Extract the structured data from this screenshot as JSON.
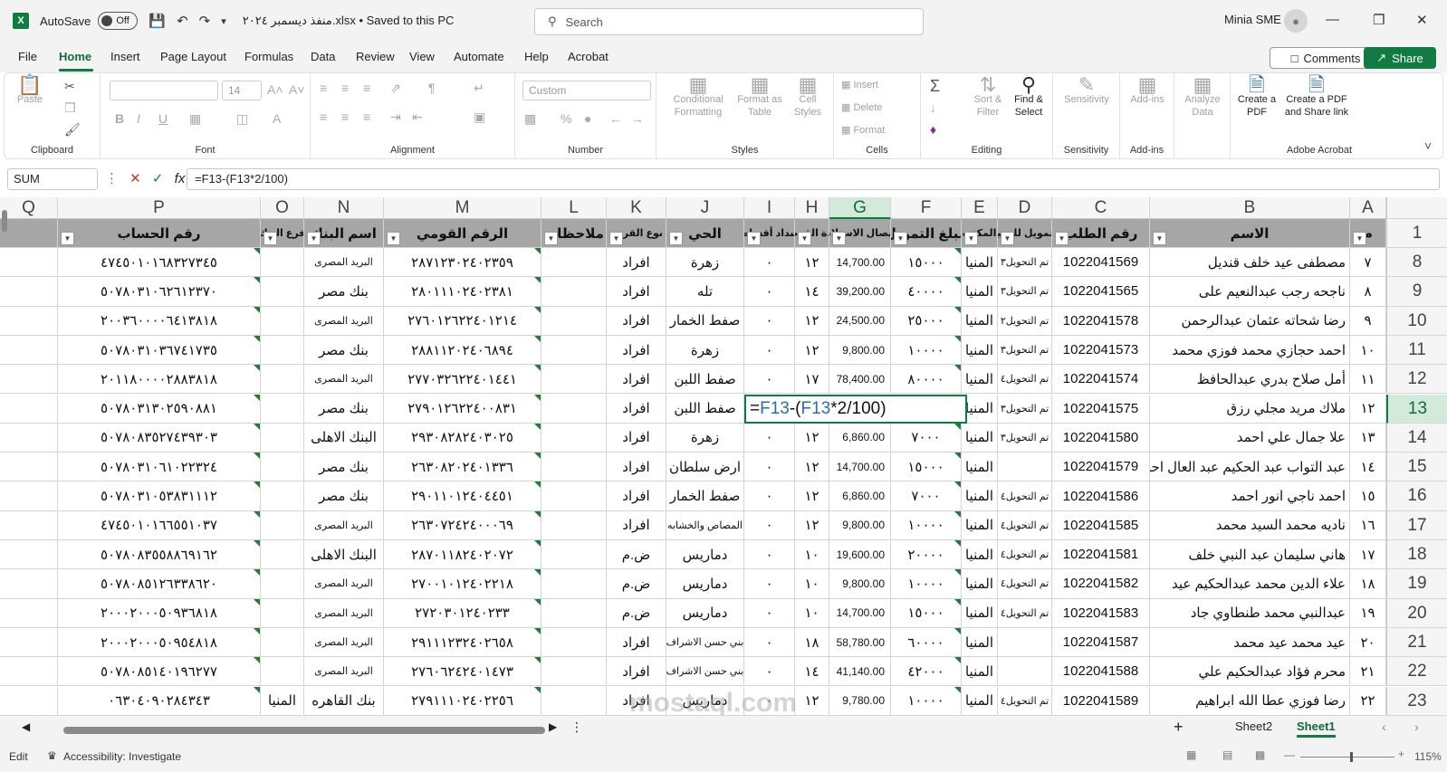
{
  "titlebar": {
    "autosave_label": "AutoSave",
    "autosave_state": "Off",
    "filename": "منفذ ديسمبر ٢٠٢٤.xlsx • Saved to this PC",
    "search_placeholder": "Search",
    "user_name": "Minia SME"
  },
  "menu": {
    "items": [
      "File",
      "Home",
      "Insert",
      "Page Layout",
      "Formulas",
      "Data",
      "Review",
      "View",
      "Automate",
      "Help",
      "Acrobat"
    ],
    "comments": "Comments",
    "share": "Share"
  },
  "ribbon": {
    "clipboard": {
      "label": "Clipboard",
      "paste": "Paste"
    },
    "font": {
      "label": "Font",
      "size": "14"
    },
    "alignment": {
      "label": "Alignment"
    },
    "number": {
      "label": "Number",
      "format": "Custom"
    },
    "styles": {
      "label": "Styles",
      "conditional": "Conditional Formatting",
      "format_table": "Format as Table",
      "cell_styles": "Cell Styles"
    },
    "cells": {
      "label": "Cells",
      "insert": "Insert",
      "delete": "Delete",
      "format": "Format"
    },
    "editing": {
      "label": "Editing",
      "sort": "Sort & Filter",
      "find": "Find & Select"
    },
    "sensitivity": {
      "label": "Sensitivity",
      "btn": "Sensitivity"
    },
    "addins": {
      "label": "Add-ins",
      "btn": "Add-ins"
    },
    "analyze": {
      "btn": "Analyze Data"
    },
    "acrobat": {
      "label": "Adobe Acrobat",
      "create_pdf": "Create a PDF",
      "create_share": "Create a PDF and Share link"
    }
  },
  "formula_bar": {
    "name_box": "SUM",
    "formula": "=F13-(F13*2/100)"
  },
  "columns": {
    "letters": [
      "A",
      "B",
      "C",
      "D",
      "E",
      "F",
      "G",
      "H",
      "I",
      "J",
      "K",
      "L",
      "M",
      "N",
      "O",
      "P",
      "Q"
    ],
    "selected": "G"
  },
  "header_row": {
    "row_number": "1",
    "A": "م",
    "B": "الاسم",
    "C": "رقم الطلب",
    "D": "التمويل للعميل",
    "E": "المكتب",
    "F": "مبلغ التمويل",
    "G": "إيصال الاستلام",
    "H": "مدة القرض",
    "I": "سداد أقساط",
    "J": "الحي",
    "K": "نوع القرض",
    "L": "ملاحظات",
    "M": "الرقم القومي",
    "N": "اسم البنك",
    "O": "فرع البنك",
    "P": "رقم الحساب"
  },
  "selected_row": "13",
  "edit_cell": {
    "prefix": "=",
    "ref1": "F13",
    "mid": "-(",
    "ref2": "F13",
    "suffix": "*2/100)"
  },
  "rows": [
    {
      "r": "8",
      "A": "٧",
      "B": "مصطفى عيد خلف قنديل",
      "C": "1022041569",
      "D": "تم التحويل٣",
      "E": "المنيا",
      "F": "١٥٠٠٠",
      "G": "14,700.00",
      "H": "١٢",
      "I": "٠",
      "J": "زهرة",
      "K": "افراد",
      "M": "٢٨٧١٢٣٠٢٤٠٢٣٥٩",
      "N": "البريد المصرى",
      "O": "",
      "P": "٤٧٤٥٠١٠١٦٨٣٢٧٣٤٥"
    },
    {
      "r": "9",
      "A": "٨",
      "B": "ناجحه رجب عبدالنعيم على",
      "C": "1022041565",
      "D": "تم التحويل٣",
      "E": "المنيا",
      "F": "٤٠٠٠٠",
      "G": "39,200.00",
      "H": "١٤",
      "I": "٠",
      "J": "تله",
      "K": "افراد",
      "M": "٢٨٠١١١٠٢٤٠٢٣٨١",
      "N": "بنك مصر",
      "O": "",
      "P": "٥٠٧٨٠٣١٠٦٢٦١٢٣٧٠"
    },
    {
      "r": "10",
      "A": "٩",
      "B": "رضا شحاته عثمان عبدالرحمن",
      "C": "1022041578",
      "D": "تم التحويل٢",
      "E": "المنيا",
      "F": "٢٥٠٠٠",
      "G": "24,500.00",
      "H": "١٢",
      "I": "٠",
      "J": "صفط الخمار",
      "K": "افراد",
      "M": "٢٧٦٠١٢٦٢٢٤٠١٢١٤",
      "N": "البريد المصرى",
      "O": "",
      "P": "٢٠٠٣٦٠٠٠٠٦٤١٣٨١٨"
    },
    {
      "r": "11",
      "A": "١٠",
      "B": "احمد حجازي محمد فوزي محمد",
      "C": "1022041573",
      "D": "تم التحويل٣",
      "E": "المنيا",
      "F": "١٠٠٠٠",
      "G": "9,800.00",
      "H": "١٢",
      "I": "٠",
      "J": "زهرة",
      "K": "افراد",
      "M": "٢٨٨١١٢٠٢٤٠٦٨٩٤",
      "N": "بنك مصر",
      "O": "",
      "P": "٥٠٧٨٠٣١٠٣٦٧٤١٧٣٥"
    },
    {
      "r": "12",
      "A": "١١",
      "B": "أمل صلاح بدري عبدالحافظ",
      "C": "1022041574",
      "D": "تم التحويل٤",
      "E": "المنيا",
      "F": "٨٠٠٠٠",
      "G": "78,400.00",
      "H": "١٧",
      "I": "٠",
      "J": "صفط اللبن",
      "K": "افراد",
      "M": "٢٧٧٠٣٢٦٢٢٤٠١٤٤١",
      "N": "البريد المصرى",
      "O": "",
      "P": "٢٠١١٨٠٠٠٠٢٨٨٣٨١٨"
    },
    {
      "r": "13",
      "A": "١٢",
      "B": "ملاك مريد مجلي رزق",
      "C": "1022041575",
      "D": "تم التحويل٣",
      "E": "المنيا",
      "F": "",
      "G": "",
      "H": "",
      "I": "",
      "J": "صفط اللبن",
      "K": "افراد",
      "M": "٢٧٩٠١٢٦٢٢٤٠٠٨٣١",
      "N": "بنك مصر",
      "O": "",
      "P": "٥٠٧٨٠٣١٣٠٢٥٩٠٨٨١"
    },
    {
      "r": "14",
      "A": "١٣",
      "B": "علا جمال علي احمد",
      "C": "1022041580",
      "D": "تم التحويل٣",
      "E": "المنيا",
      "F": "٧٠٠٠",
      "G": "6,860.00",
      "H": "١٢",
      "I": "٠",
      "J": "زهرة",
      "K": "افراد",
      "M": "٢٩٣٠٨٢٨٢٤٠٣٠٢٥",
      "N": "البنك الاهلى",
      "O": "",
      "P": "٥٠٧٨٠٨٣٥٢٧٤٣٩٣٠٣"
    },
    {
      "r": "15",
      "A": "١٤",
      "B": "عبد التواب عبد الحكيم عبد العال احمد",
      "C": "1022041579",
      "D": "",
      "E": "المنيا",
      "F": "١٥٠٠٠",
      "G": "14,700.00",
      "H": "١٢",
      "I": "٠",
      "J": "ارض سلطان",
      "K": "افراد",
      "M": "٢٦٣٠٨٢٠٢٤٠١٣٣٦",
      "N": "بنك مصر",
      "O": "",
      "P": "٥٠٧٨٠٣١٠٦١٠٢٢٣٢٤"
    },
    {
      "r": "16",
      "A": "١٥",
      "B": "احمد ناجي انور احمد",
      "C": "1022041586",
      "D": "تم التحويل٤",
      "E": "المنيا",
      "F": "٧٠٠٠",
      "G": "6,860.00",
      "H": "١٢",
      "I": "٠",
      "J": "صفط الخمار",
      "K": "افراد",
      "M": "٢٩٠١١٠١٢٤٠٤٤٥١",
      "N": "بنك مصر",
      "O": "",
      "P": "٥٠٧٨٠٣١٠٥٣٨٣١١١٢"
    },
    {
      "r": "17",
      "A": "١٦",
      "B": "ناديه محمد السيد محمد",
      "C": "1022041585",
      "D": "تم التحويل٤",
      "E": "المنيا",
      "F": "١٠٠٠٠",
      "G": "9,800.00",
      "H": "١٢",
      "I": "٠",
      "J": "المصاص والخشابه",
      "K": "افراد",
      "M": "٢٦٣٠٧٢٤٢٤٠٠٠٦٩",
      "N": "البريد المصرى",
      "O": "",
      "P": "٤٧٤٥٠١٠١٦٦٥٥١٠٣٧"
    },
    {
      "r": "18",
      "A": "١٧",
      "B": "هاني سليمان عبد النبي خلف",
      "C": "1022041581",
      "D": "تم التحويل٤",
      "E": "المنيا",
      "F": "٢٠٠٠٠",
      "G": "19,600.00",
      "H": "١٠",
      "I": "٠",
      "J": "دماريس",
      "K": "ض.م",
      "M": "٢٨٧٠١١٨٢٤٠٢٠٧٢",
      "N": "البنك الاهلى",
      "O": "",
      "P": "٥٠٧٨٠٨٣٥٥٨٨٦٩١٦٢"
    },
    {
      "r": "19",
      "A": "١٨",
      "B": "علاء الدين محمد عبدالحكيم عيد",
      "C": "1022041582",
      "D": "تم التحويل٤",
      "E": "المنيا",
      "F": "١٠٠٠٠",
      "G": "9,800.00",
      "H": "١٠",
      "I": "٠",
      "J": "دماريس",
      "K": "ض.م",
      "M": "٢٧٠٠١٠١٢٤٠٢٢١٨",
      "N": "البريد المصرى",
      "O": "",
      "P": "٥٠٧٨٠٨٥١٢٦٣٣٨٦٢٠"
    },
    {
      "r": "20",
      "A": "١٩",
      "B": "عبدالنبي محمد طنطاوي جاد",
      "C": "1022041583",
      "D": "تم التحويل٤",
      "E": "المنيا",
      "F": "١٥٠٠٠",
      "G": "14,700.00",
      "H": "١٠",
      "I": "٠",
      "J": "دماريس",
      "K": "ض.م",
      "M": "٢٧٢٠٣٠١٢٤٠٢٣٣",
      "N": "البريد المصرى",
      "O": "",
      "P": "٢٠٠٠٢٠٠٠٥٠٩٣٦٨١٨"
    },
    {
      "r": "21",
      "A": "٢٠",
      "B": "عيد محمد عيد محمد",
      "C": "1022041587",
      "D": "",
      "E": "المنيا",
      "F": "٦٠٠٠٠",
      "G": "58,780.00",
      "H": "١٨",
      "I": "٠",
      "J": "بني حسن الاشراف",
      "K": "افراد",
      "M": "٢٩١١١٢٣٢٤٠٢٦٥٨",
      "N": "البريد المصرى",
      "O": "",
      "P": "٢٠٠٠٢٠٠٠٥٠٩٥٤٨١٨"
    },
    {
      "r": "22",
      "A": "٢١",
      "B": "محرم فؤاد عبدالحكيم علي",
      "C": "1022041588",
      "D": "",
      "E": "المنيا",
      "F": "٤٢٠٠٠",
      "G": "41,140.00",
      "H": "١٤",
      "I": "٠",
      "J": "بني حسن الاشراف",
      "K": "افراد",
      "M": "٢٧٦٠٦٢٤٢٤٠١٤٧٣",
      "N": "البريد المصرى",
      "O": "",
      "P": "٥٠٧٨٠٨٥١٤٠١٩٦٢٧٧"
    },
    {
      "r": "23",
      "A": "٢٢",
      "B": "رضا فوزي عطا الله ابراهيم",
      "C": "1022041589",
      "D": "تم التحويل٤",
      "E": "المنيا",
      "F": "١٠٠٠٠",
      "G": "9,780.00",
      "H": "١٢",
      "I": "٠",
      "J": "دماريس",
      "K": "افراد",
      "M": "٢٧٩١١١٠٢٤٠٢٢٥٦",
      "N": "بنك القاهره",
      "O": "المنيا",
      "P": "٠٦٣٠٤٠٩٠٢٨٤٣٤٣"
    }
  ],
  "sheets": {
    "tabs": [
      "Sheet2",
      "Sheet1"
    ],
    "active": "Sheet1"
  },
  "status": {
    "mode": "Edit",
    "accessibility": "Accessibility: Investigate",
    "zoom": "115%"
  },
  "watermark": "mostaql.com"
}
